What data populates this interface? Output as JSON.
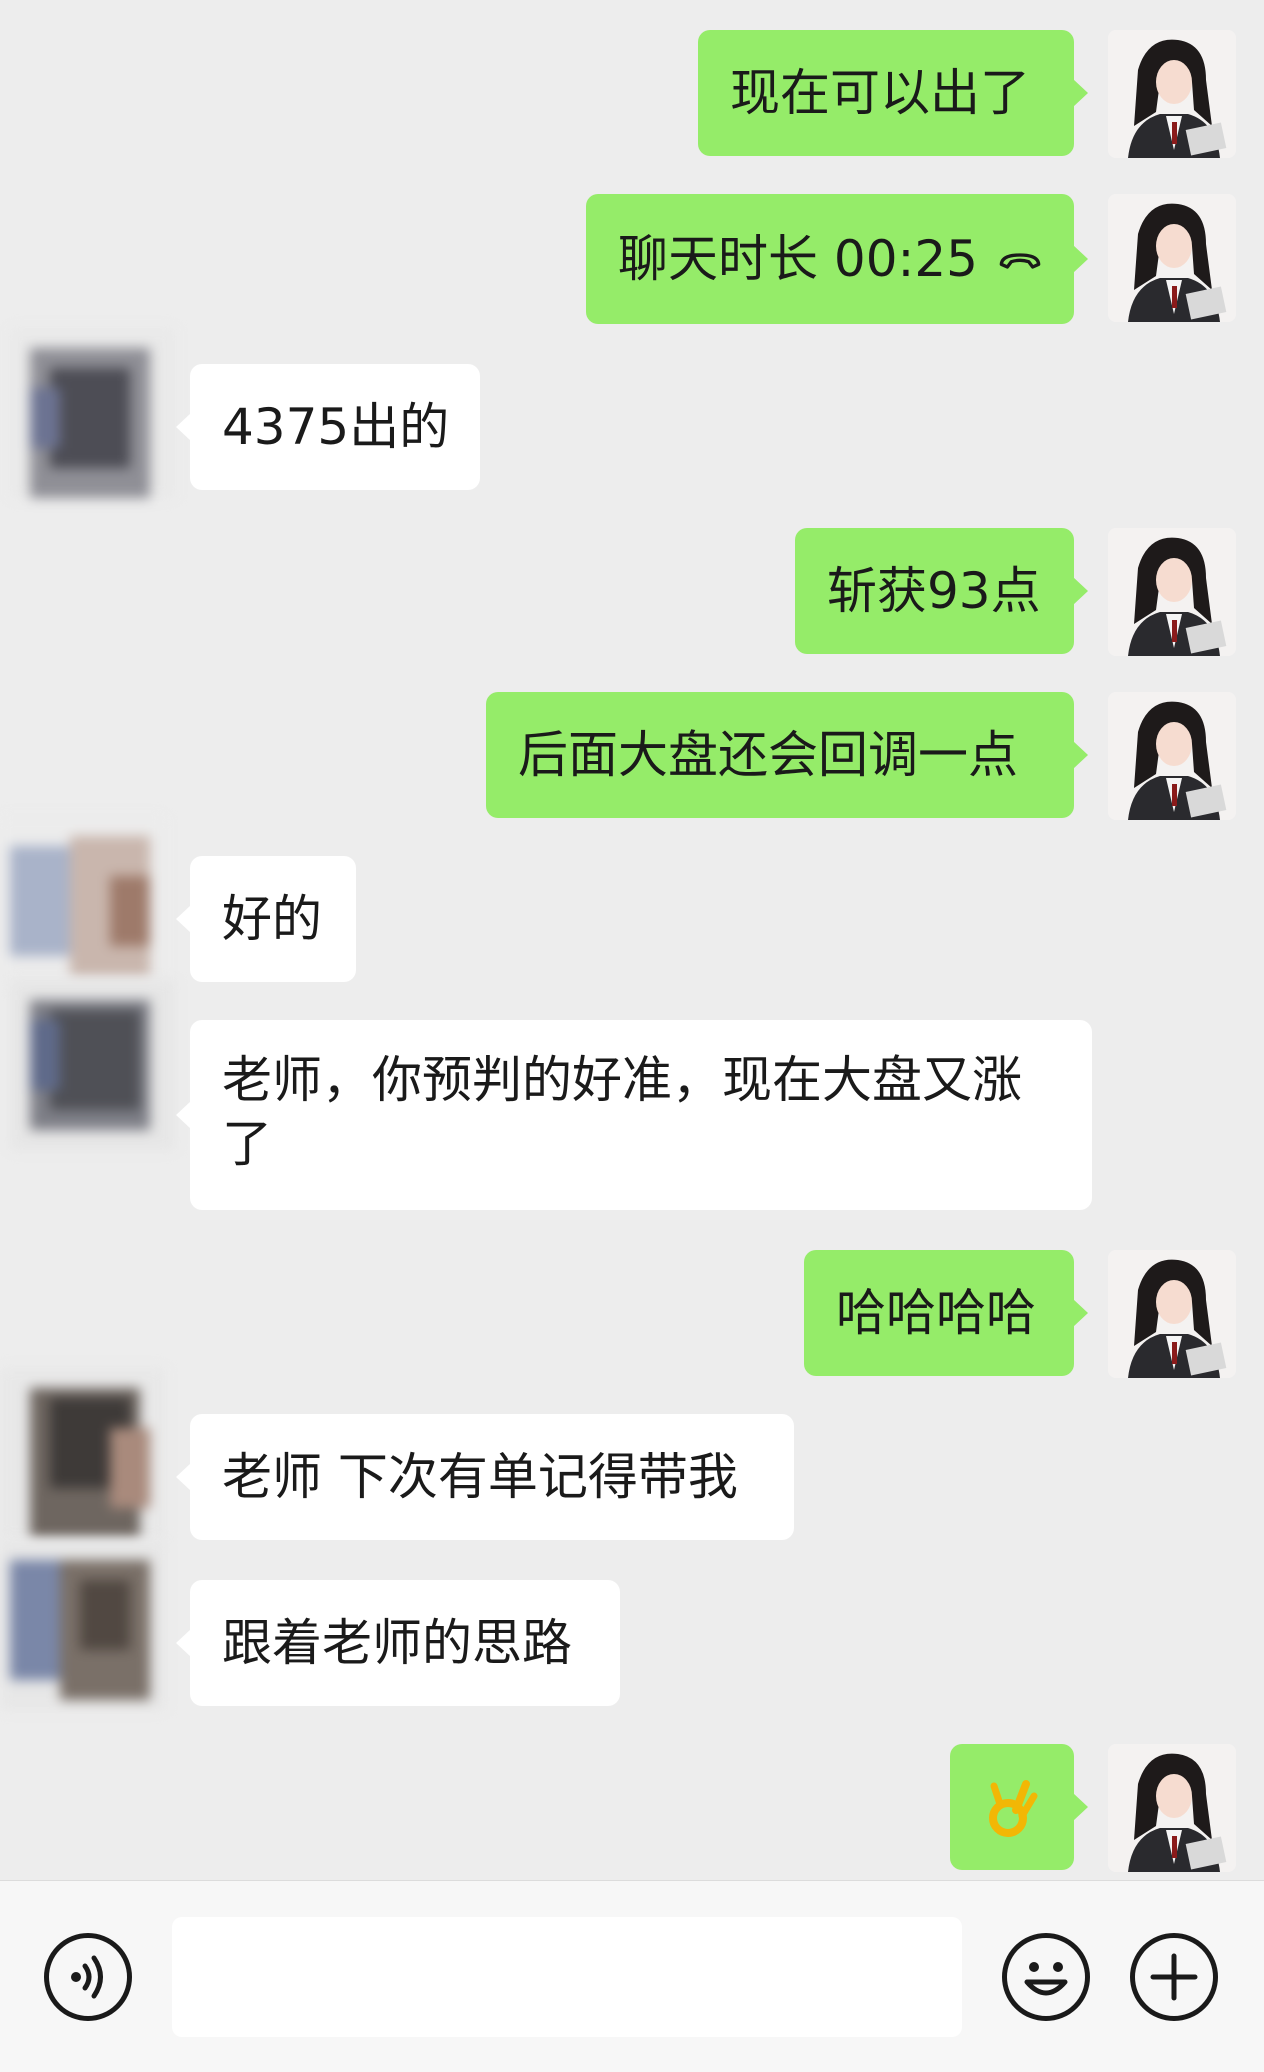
{
  "messages": [
    {
      "side": "out",
      "text": "现在可以出了"
    },
    {
      "side": "out",
      "text": "聊天时长 00:25",
      "icon": "call-hangup-icon"
    },
    {
      "side": "in",
      "text": "4375出的"
    },
    {
      "side": "out",
      "text": "斩获93点"
    },
    {
      "side": "out",
      "text": "后面大盘还会回调一点"
    },
    {
      "side": "in",
      "text": "好的"
    },
    {
      "side": "in",
      "text": "老师，你预判的好准，现在大盘又涨了"
    },
    {
      "side": "out",
      "text": "哈哈哈哈"
    },
    {
      "side": "in",
      "text": "老师 下次有单记得带我"
    },
    {
      "side": "in",
      "text": "跟着老师的思路"
    },
    {
      "side": "out",
      "emoji": "ok-hand-emoji"
    }
  ],
  "bottom_bar": {
    "voice_icon": "voice-input-icon",
    "input_value": "",
    "emoji_icon": "emoji-icon",
    "plus_icon": "plus-icon"
  },
  "colors": {
    "outgoing_bubble": "#95ec69",
    "incoming_bubble": "#ffffff",
    "background": "#ededed"
  }
}
